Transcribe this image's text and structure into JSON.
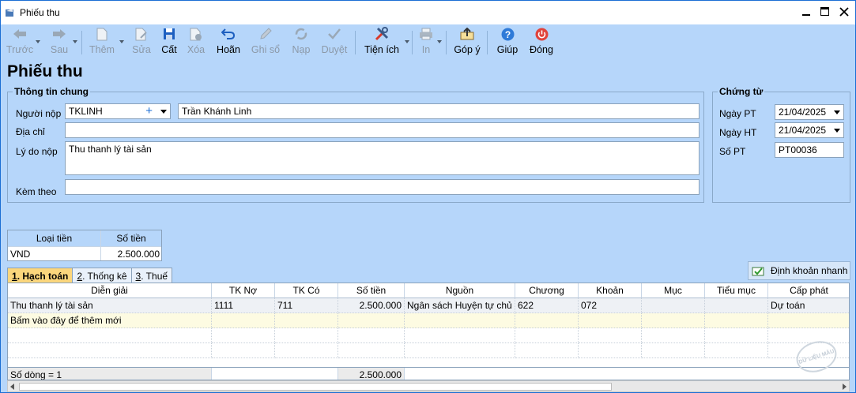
{
  "window": {
    "title": "Phiếu thu"
  },
  "toolbar": {
    "buttons": [
      {
        "label": "Trước"
      },
      {
        "label": "Sau"
      },
      {
        "label": "Thêm"
      },
      {
        "label": "Sửa"
      },
      {
        "label": "Cất"
      },
      {
        "label": "Xóa"
      },
      {
        "label": "Hoãn"
      },
      {
        "label": "Ghi sổ"
      },
      {
        "label": "Nạp"
      },
      {
        "label": "Duyệt"
      },
      {
        "label": "Tiện ích"
      },
      {
        "label": "In"
      },
      {
        "label": "Góp ý"
      },
      {
        "label": "Giúp"
      },
      {
        "label": "Đóng"
      }
    ]
  },
  "page": {
    "title": "Phiếu thu"
  },
  "general": {
    "title": "Thông tin chung",
    "payer_label": "Người nộp",
    "payer_code": "TKLINH",
    "payer_name": "Trần Khánh Linh",
    "address_label": "Địa chỉ",
    "address_value": "",
    "reason_label": "Lý do nộp",
    "reason_value": "Thu thanh lý tài sản",
    "attach_label": "Kèm theo",
    "attach_value": ""
  },
  "voucher": {
    "title": "Chứng từ",
    "pt_date_label": "Ngày PT",
    "pt_date": "21/04/2025",
    "ht_date_label": "Ngày HT",
    "ht_date": "21/04/2025",
    "number_label": "Số PT",
    "number": "PT00036"
  },
  "money": {
    "headers": [
      "Loại tiền",
      "Số tiền"
    ],
    "currency": "VND",
    "amount": "2.500.000"
  },
  "quick_entry": {
    "label": "Định khoản nhanh"
  },
  "tabs": [
    {
      "key": "1",
      "label": ". Hạch toán"
    },
    {
      "key": "2",
      "label": ". Thống kê"
    },
    {
      "key": "3",
      "label": ". Thuế"
    }
  ],
  "grid": {
    "columns": [
      "Diễn giải",
      "TK Nợ",
      "TK Có",
      "Số tiền",
      "Nguồn",
      "Chương",
      "Khoản",
      "Mục",
      "Tiểu mục",
      "Cấp phát"
    ],
    "rows": [
      [
        "Thu thanh lý tài sản",
        "1111",
        "711",
        "2.500.000",
        "Ngân sách Huyện tự chủ",
        "622",
        "072",
        "",
        "",
        "Dự toán"
      ]
    ],
    "add_row_text": "Bấm vào đây để thêm mới",
    "footer_count": "Số dòng = 1",
    "footer_total": "2.500.000"
  },
  "stamp_text": "DỮ LIỆU MẪU",
  "colors": {
    "accent": "#1b6ed4",
    "background": "#b6d6fa",
    "active_tab": "#fbd67c"
  }
}
